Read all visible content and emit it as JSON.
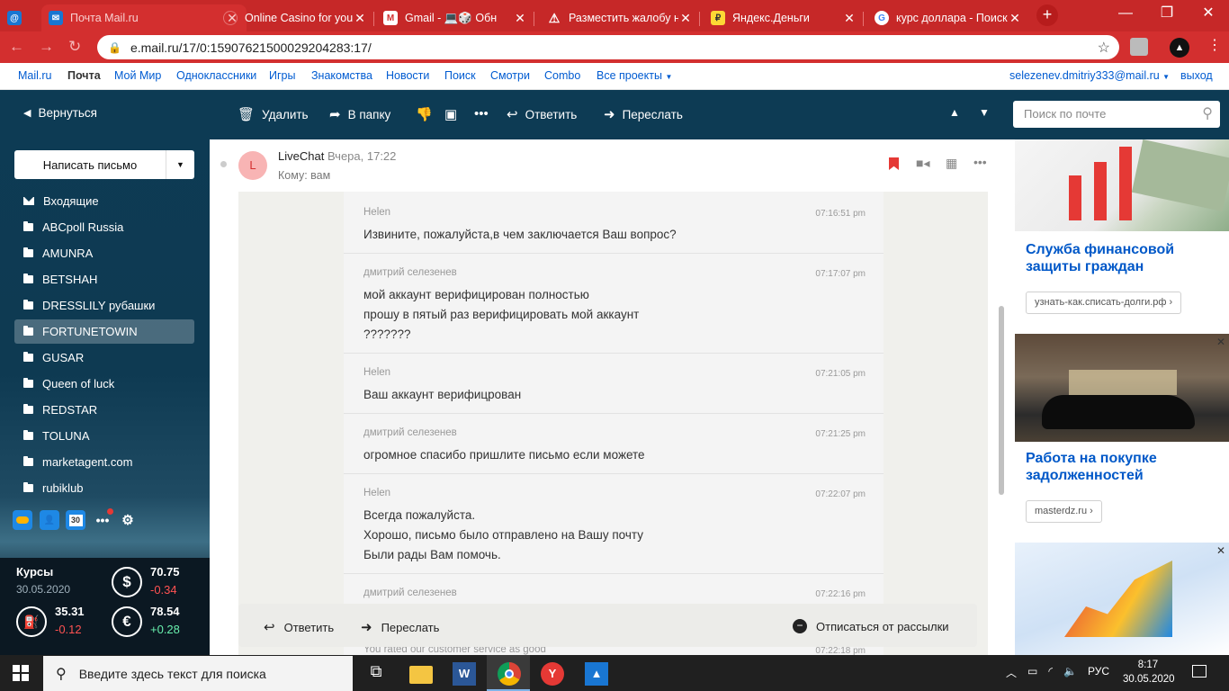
{
  "browser": {
    "tabs": [
      {
        "title": "Почта Mail.ru",
        "active": true,
        "fav_color": "#1976d2"
      },
      {
        "title": "Online Casino for you",
        "active": false,
        "fav_color": "#c62828"
      },
      {
        "title": "Gmail - 💻🎲 Обн",
        "active": false,
        "fav_color": "#ffffff"
      },
      {
        "title": "Разместить жалобу на",
        "active": false,
        "fav_color": "#c62828"
      },
      {
        "title": "Яндекс.Деньги",
        "active": false,
        "fav_color": "#fdd835"
      },
      {
        "title": "курс доллара - Поиск",
        "active": false,
        "fav_color": "#ffffff"
      }
    ],
    "url": "e.mail.ru/17/0:15907621500029204283:17/",
    "first_tab_icon": "@"
  },
  "portal": {
    "links": [
      "Mail.ru",
      "Почта",
      "Мой Мир",
      "Одноклассники",
      "Игры",
      "Знакомства",
      "Новости",
      "Поиск",
      "Смотри",
      "Combo",
      "Все проекты"
    ],
    "user_email": "selezenev.dmitriy333@mail.ru",
    "logout": "выход"
  },
  "toolbar": {
    "back": "Вернуться",
    "delete": "Удалить",
    "to_folder": "В папку",
    "reply": "Ответить",
    "forward": "Переслать",
    "search_placeholder": "Поиск по почте"
  },
  "sidebar": {
    "compose": "Написать письмо",
    "folders": [
      {
        "name": "Входящие",
        "icon": "mail-icon"
      },
      {
        "name": "ABCpoll Russia",
        "icon": "folder-icon"
      },
      {
        "name": "AMUNRA",
        "icon": "folder-icon"
      },
      {
        "name": "BETSHAH",
        "icon": "folder-icon"
      },
      {
        "name": "DRESSLILY рубашки",
        "icon": "folder-icon"
      },
      {
        "name": "FORTUNETOWIN",
        "icon": "folder-icon",
        "selected": true
      },
      {
        "name": "GUSAR",
        "icon": "folder-icon"
      },
      {
        "name": "Queen of luck",
        "icon": "folder-icon"
      },
      {
        "name": "REDSTAR",
        "icon": "folder-icon"
      },
      {
        "name": "TOLUNA",
        "icon": "folder-icon"
      },
      {
        "name": "marketagent.com",
        "icon": "folder-icon"
      },
      {
        "name": "rubiklub",
        "icon": "folder-icon"
      }
    ],
    "calendar_day": "30"
  },
  "rates": {
    "title": "Курсы",
    "date": "30.05.2020",
    "usd": {
      "value": "70.75",
      "change": "-0.34"
    },
    "eur": {
      "value": "78.54",
      "change": "+0.28"
    },
    "oil": {
      "value": "35.31",
      "change": "-0.12"
    }
  },
  "letter": {
    "avatar": "L",
    "sender": "LiveChat",
    "date": "Вчера, 17:22",
    "to": "Кому: вам"
  },
  "chat": [
    {
      "author": "Helen",
      "time": "07:16:51 pm",
      "lines": [
        "Извините, пожалуйста,в чем заключается Ваш вопрос?"
      ]
    },
    {
      "author": "дмитрий селезенев",
      "time": "07:17:07 pm",
      "lines": [
        "мой аккаунт верифицирован полностью",
        "прошу в пятый раз верифицировать мой аккаунт",
        "???????"
      ]
    },
    {
      "author": "Helen",
      "time": "07:21:05 pm",
      "lines": [
        "Ваш аккаунт верифицрован"
      ]
    },
    {
      "author": "дмитрий селезенев",
      "time": "07:21:25 pm",
      "lines": [
        "огромное спасибо пришлите письмо если можете"
      ]
    },
    {
      "author": "Helen",
      "time": "07:22:07 pm",
      "lines": [
        "Всегда пожалуйста.",
        "Хорошо, письмо было отправлено на Вашу почту",
        "Были рады Вам помочь."
      ]
    },
    {
      "author": "дмитрий селезенев",
      "time": "07:22:16 pm",
      "lines": []
    },
    {
      "author": "You rated our customer service as good",
      "time": "07:22:18 pm",
      "lines": []
    }
  ],
  "replybar": {
    "reply": "Ответить",
    "forward": "Переслать",
    "unsubscribe": "Отписаться от рассылки"
  },
  "ads": [
    {
      "title": "Служба финансовой защиты граждан",
      "button": "узнать-как.списать-долги.рф"
    },
    {
      "title": "Работа на покупке задолженностей",
      "button": "masterdz.ru"
    }
  ],
  "taskbar": {
    "search_placeholder": "Введите здесь текст для поиска",
    "lang": "РУС",
    "time": "8:17",
    "date": "30.05.2020"
  }
}
